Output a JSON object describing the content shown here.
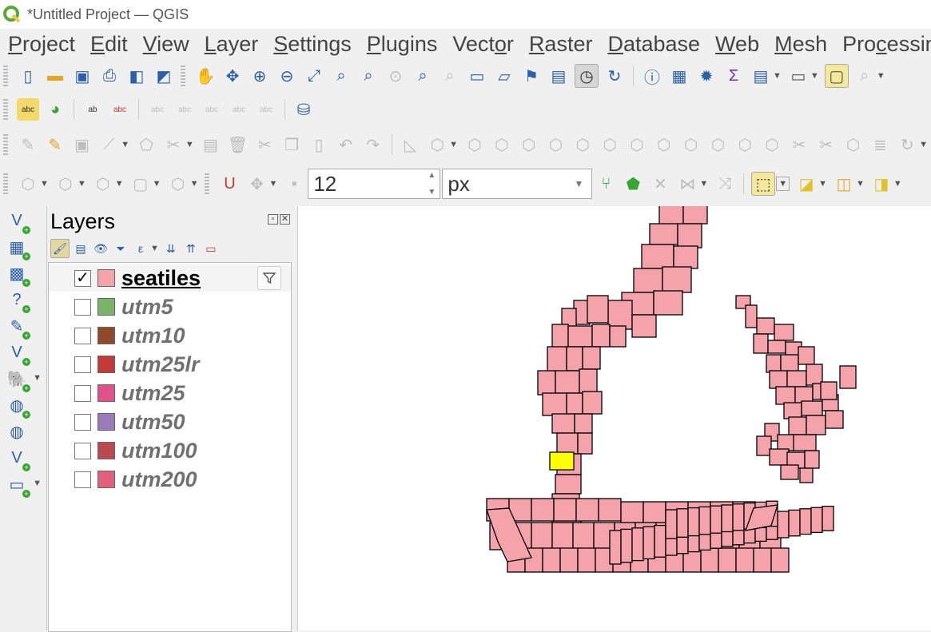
{
  "window": {
    "title": "*Untitled Project — QGIS"
  },
  "menu": [
    {
      "pre": "",
      "u": "P",
      "post": "roject"
    },
    {
      "pre": "",
      "u": "E",
      "post": "dit"
    },
    {
      "pre": "",
      "u": "V",
      "post": "iew"
    },
    {
      "pre": "",
      "u": "L",
      "post": "ayer"
    },
    {
      "pre": "",
      "u": "S",
      "post": "ettings"
    },
    {
      "pre": "",
      "u": "P",
      "post": "lugins"
    },
    {
      "pre": "Vect",
      "u": "o",
      "post": "r"
    },
    {
      "pre": "",
      "u": "R",
      "post": "aster"
    },
    {
      "pre": "",
      "u": "D",
      "post": "atabase"
    },
    {
      "pre": "",
      "u": "W",
      "post": "eb"
    },
    {
      "pre": "",
      "u": "M",
      "post": "esh"
    },
    {
      "pre": "Pro",
      "u": "c",
      "post": "essing"
    }
  ],
  "snapping": {
    "tolerance": "12",
    "units": "px"
  },
  "layers_panel": {
    "title": "Layers",
    "layers": [
      {
        "name": "seatiles",
        "checked": true,
        "color": "#f4a3aa",
        "active": true
      },
      {
        "name": "utm5",
        "checked": false,
        "color": "#7ab36a",
        "active": false
      },
      {
        "name": "utm10",
        "checked": false,
        "color": "#8e4a2a",
        "active": false
      },
      {
        "name": "utm25lr",
        "checked": false,
        "color": "#c23a3a",
        "active": false
      },
      {
        "name": "utm25",
        "checked": false,
        "color": "#e0528a",
        "active": false
      },
      {
        "name": "utm50",
        "checked": false,
        "color": "#9a7bbb",
        "active": false
      },
      {
        "name": "utm100",
        "checked": false,
        "color": "#b84a50",
        "active": false
      },
      {
        "name": "utm200",
        "checked": false,
        "color": "#e0607e",
        "active": false
      }
    ]
  },
  "map": {
    "fill_color": "#f4a3aa",
    "selected_color": "#ffff00",
    "stroke_color": "#000000"
  }
}
